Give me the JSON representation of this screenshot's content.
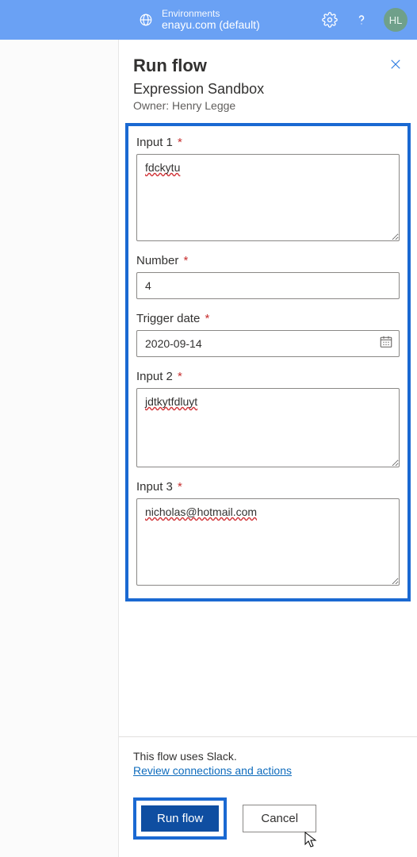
{
  "header": {
    "env_label": "Environments",
    "env_name": "enayu.com (default)",
    "avatar_initials": "HL"
  },
  "panel": {
    "title": "Run flow",
    "subtitle": "Expression Sandbox",
    "owner": "Owner: Henry Legge"
  },
  "fields": {
    "input1": {
      "label": "Input 1",
      "value": "fdckytu"
    },
    "number": {
      "label": "Number",
      "value": "4"
    },
    "trigger_date": {
      "label": "Trigger date",
      "value": "2020-09-14"
    },
    "input2": {
      "label": "Input 2",
      "value": "jdtkytfdluyt"
    },
    "input3": {
      "label": "Input 3",
      "value": "nicholas@hotmail.com"
    }
  },
  "footer": {
    "uses_text": "This flow uses Slack.",
    "review_link": "Review connections and actions",
    "run_label": "Run flow",
    "cancel_label": "Cancel"
  },
  "required_mark": "*"
}
